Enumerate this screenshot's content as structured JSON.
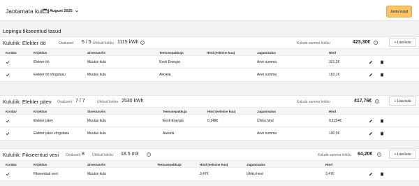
{
  "header": {
    "title": "Jaotamata kulud",
    "month": "August 2025",
    "share_button": "Jaota kulud"
  },
  "section_title": "Lepingu fikseeritud tasud",
  "labels": {
    "participants": "Osalused",
    "units_total": "Ühikud kokku",
    "costs_total": "Kulude summa kokku",
    "add_cost": "+ Lisa kulu"
  },
  "groups": [
    {
      "title": "Kululiik: Elekter öö",
      "participants": "5 / 5",
      "units": "1115 kWh",
      "sum": "423,30€",
      "columns": [
        "Korduv",
        "Kirjeldus",
        "Sisestusviis",
        "Teenusepakkuja",
        "Hind (eelmine kuu)",
        "Jagamisalus",
        "Hind"
      ],
      "rows": [
        {
          "recurring": true,
          "description": "Elekter öö",
          "input": "Muutuv kulu",
          "provider": "Eesti Energia",
          "prev": "",
          "basis": "Arve summa",
          "price": "321,2€"
        },
        {
          "recurring": true,
          "description": "Elekter öö võrgutasu",
          "input": "Muutuv kulu",
          "provider": "Alexela",
          "prev": "",
          "basis": "Arve summa",
          "price": "102,1€"
        }
      ]
    },
    {
      "title": "Kululiik: Elekter päev",
      "participants": "7 / 7",
      "units": "2530 kWh",
      "sum": "417,76€",
      "columns": [
        "Korduv",
        "Kirjeldus",
        "Sisestusviis",
        "Teenusepakkuja",
        "Hind (eelmine kuu)",
        "Jagamisalus",
        "Hind"
      ],
      "rows": [
        {
          "recurring": true,
          "description": "Elekter päev",
          "input": "Muutuv kulu",
          "provider": "Eesti Energia",
          "prev": "0,148€",
          "basis": "Ühiku hind",
          "price": "0,1254€"
        },
        {
          "recurring": true,
          "description": "Elekter päev võrgutasu",
          "input": "Muutuv kulu",
          "provider": "Alexela",
          "prev": "",
          "basis": "Arve summa",
          "price": "100,5€"
        }
      ]
    },
    {
      "title": "Kululiik: Fikseeritud vesi",
      "participants": "8",
      "units": "18.5 m3",
      "sum": "64,20€",
      "columns": [
        "Korduv",
        "Kirjeldus",
        "Sisestusviis",
        "Teenusepakkuja",
        "Hind (eelmine kuu)",
        "Jagamisalus",
        "Hind"
      ],
      "rows": [
        {
          "recurring": true,
          "description": "Fikseeritud vesi",
          "input": "Muutuv kulu",
          "provider": "",
          "prev": "3,47€",
          "basis": "Ühiku hind",
          "price": "3,47€"
        }
      ]
    }
  ]
}
